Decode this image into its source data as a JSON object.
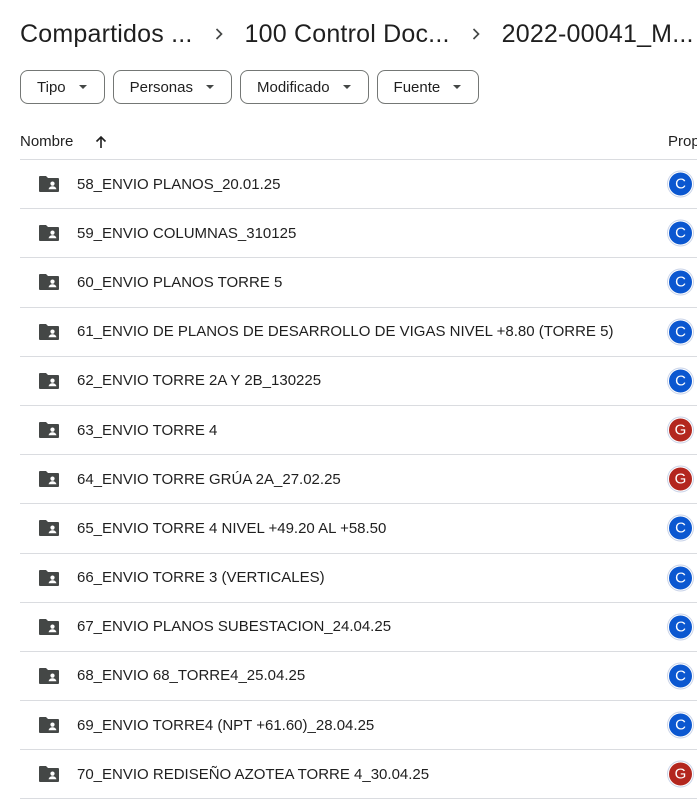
{
  "breadcrumb": [
    {
      "label": "Compartidos ..."
    },
    {
      "label": "100 Control Doc..."
    },
    {
      "label": "2022-00041_M..."
    }
  ],
  "filters": [
    {
      "label": "Tipo"
    },
    {
      "label": "Personas"
    },
    {
      "label": "Modificado"
    },
    {
      "label": "Fuente"
    }
  ],
  "table": {
    "col_name": "Nombre",
    "col_owner": "Prop"
  },
  "colors": {
    "avatar_blue": "#0b57d0",
    "avatar_red": "#b3261e",
    "folder": "#444746"
  },
  "rows": [
    {
      "name": "58_ENVIO PLANOS_20.01.25",
      "avatar": "C",
      "color": "#0b57d0"
    },
    {
      "name": "59_ENVIO COLUMNAS_310125",
      "avatar": "C",
      "color": "#0b57d0"
    },
    {
      "name": "60_ENVIO PLANOS TORRE 5",
      "avatar": "C",
      "color": "#0b57d0"
    },
    {
      "name": "61_ENVIO DE PLANOS DE DESARROLLO DE VIGAS NIVEL +8.80 (TORRE 5)",
      "avatar": "C",
      "color": "#0b57d0"
    },
    {
      "name": "62_ENVIO TORRE 2A Y 2B_130225",
      "avatar": "C",
      "color": "#0b57d0"
    },
    {
      "name": "63_ENVIO TORRE 4",
      "avatar": "G",
      "color": "#b3261e"
    },
    {
      "name": "64_ENVIO TORRE GRÚA 2A_27.02.25",
      "avatar": "G",
      "color": "#b3261e"
    },
    {
      "name": "65_ENVIO TORRE 4 NIVEL +49.20 AL +58.50",
      "avatar": "C",
      "color": "#0b57d0"
    },
    {
      "name": "66_ENVIO TORRE 3 (VERTICALES)",
      "avatar": "C",
      "color": "#0b57d0"
    },
    {
      "name": "67_ENVIO PLANOS SUBESTACION_24.04.25",
      "avatar": "C",
      "color": "#0b57d0"
    },
    {
      "name": "68_ENVIO 68_TORRE4_25.04.25",
      "avatar": "C",
      "color": "#0b57d0"
    },
    {
      "name": "69_ENVIO TORRE4 (NPT +61.60)_28.04.25",
      "avatar": "C",
      "color": "#0b57d0"
    },
    {
      "name": "70_ENVIO REDISEÑO AZOTEA TORRE 4_30.04.25",
      "avatar": "G",
      "color": "#b3261e"
    }
  ]
}
